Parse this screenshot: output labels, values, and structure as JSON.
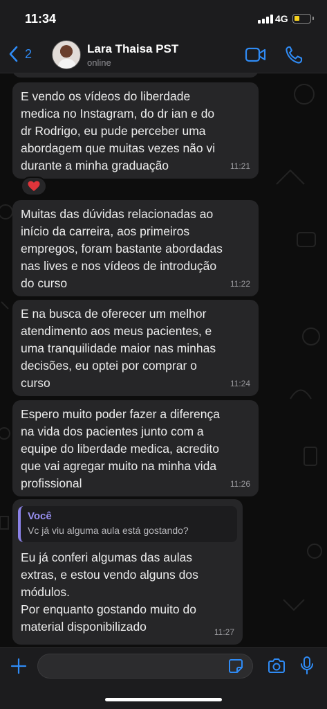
{
  "status_bar": {
    "time": "11:34",
    "network": "4G",
    "battery_level": 0.35,
    "battery_color": "#f7d21e"
  },
  "header": {
    "back_count": "2",
    "contact_name": "Lara Thaisa PST",
    "contact_status": "online",
    "accent_color": "#2f8bf5"
  },
  "messages": [
    {
      "text": "E vendo os vídeos do liberdade\nmedica no Instagram, do dr ian e do\ndr Rodrigo, eu pude perceber uma\nabordagem que muitas vezes não vi\ndurante a minha graduação",
      "time": "11:21",
      "reaction": "❤️"
    },
    {
      "text": "Muitas das dúvidas relacionadas ao\ninício da carreira, aos primeiros\nempregos, foram bastante abordadas\nnas lives e nos vídeos de introdução\ndo curso",
      "time": "11:22"
    },
    {
      "text": "E na busca de oferecer um melhor\natendimento aos meus pacientes, e\numa tranquilidade maior nas minhas\ndecisões, eu optei por comprar o\ncurso",
      "time": "11:24"
    },
    {
      "text": "Espero muito poder fazer a diferença\nna vida dos pacientes junto com a\nequipe do liberdade medica, acredito\nque vai agregar muito na minha vida\nprofissional",
      "time": "11:26"
    },
    {
      "quote_author": "Você",
      "quote_text": "Vc já viu alguma aula está gostando?",
      "text": "Eu já conferi algumas das aulas\nextras, e estou vendo alguns dos\nmódulos.\nPor enquanto gostando muito do\nmaterial disponibilizado",
      "time": "11:27"
    }
  ],
  "input_bar": {
    "icons": [
      "plus-icon",
      "sticker-icon",
      "camera-icon",
      "microphone-icon"
    ]
  }
}
